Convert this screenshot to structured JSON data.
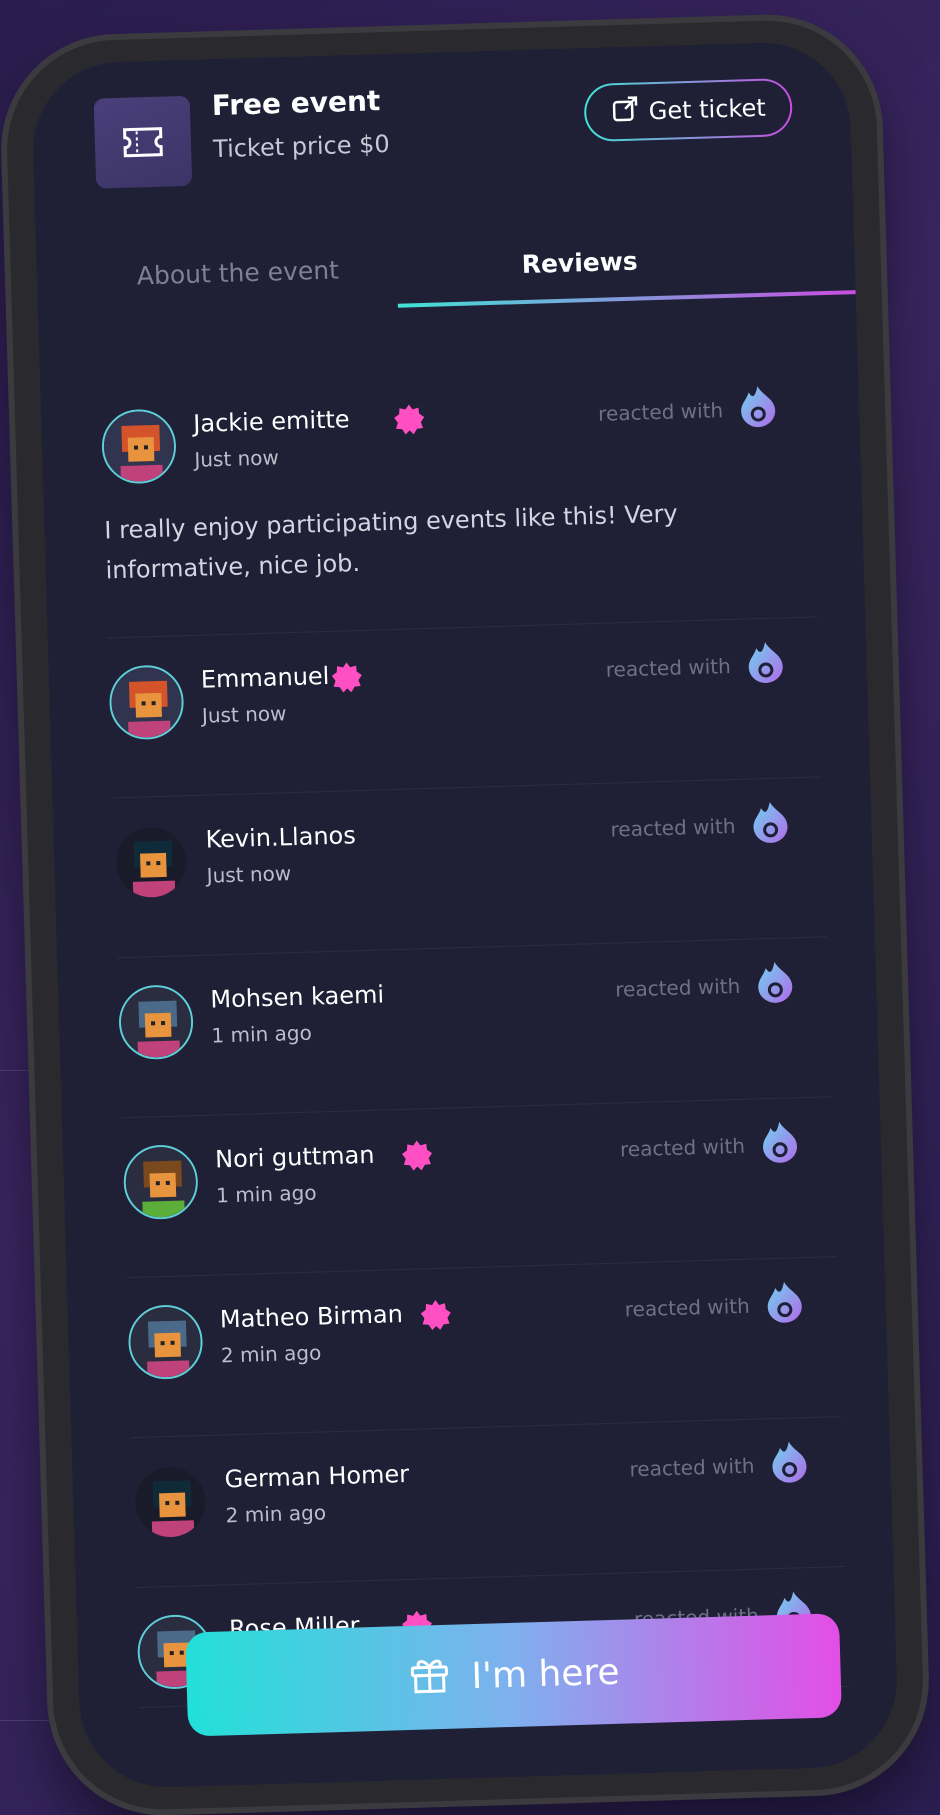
{
  "header": {
    "event_title": "Free event",
    "event_price": "Ticket price $0",
    "get_ticket_label": "Get ticket"
  },
  "tabs": [
    {
      "label": "About the event",
      "active": false
    },
    {
      "label": "Reviews",
      "active": true
    }
  ],
  "reviews": [
    {
      "name": "Jackie emitte",
      "time": "Just now",
      "verified": true,
      "reacted": "reacted with",
      "text": "I really enjoy participating events like this! Very informative, nice job.",
      "avatar": "avatar-red-hair"
    },
    {
      "name": "Emmanuel",
      "time": "Just now",
      "verified": true,
      "reacted": "reacted with",
      "avatar": "avatar-red-hair"
    },
    {
      "name": "Kevin.Llanos",
      "time": "Just now",
      "verified": false,
      "reacted": "reacted with",
      "avatar": "avatar-dark-hair"
    },
    {
      "name": "Mohsen kaemi",
      "time": "1 min ago",
      "verified": false,
      "reacted": "reacted with",
      "avatar": "avatar-cap"
    },
    {
      "name": "Nori guttman",
      "time": "1 min ago",
      "verified": true,
      "reacted": "reacted with",
      "avatar": "avatar-brown-hair"
    },
    {
      "name": "Matheo Birman",
      "time": "2 min ago",
      "verified": true,
      "reacted": "reacted with",
      "avatar": "avatar-cap"
    },
    {
      "name": "German Homer",
      "time": "2 min ago",
      "verified": false,
      "reacted": "reacted with",
      "avatar": "avatar-dark-hair"
    },
    {
      "name": "Rose Miller",
      "time": "",
      "verified": true,
      "reacted": "reacted with",
      "avatar": "avatar-cap"
    }
  ],
  "cta": {
    "label": "I'm here"
  },
  "colors": {
    "background": "#1f2036",
    "accent_start": "#22e0d8",
    "accent_end": "#e34ee6",
    "badge": "#ff4fc3",
    "muted": "#6f7088"
  },
  "icons": {
    "ticket": "ticket-icon",
    "external": "external-link-icon",
    "badge": "verified-badge-icon",
    "flame": "flame-reaction-icon",
    "gift": "gift-icon"
  }
}
